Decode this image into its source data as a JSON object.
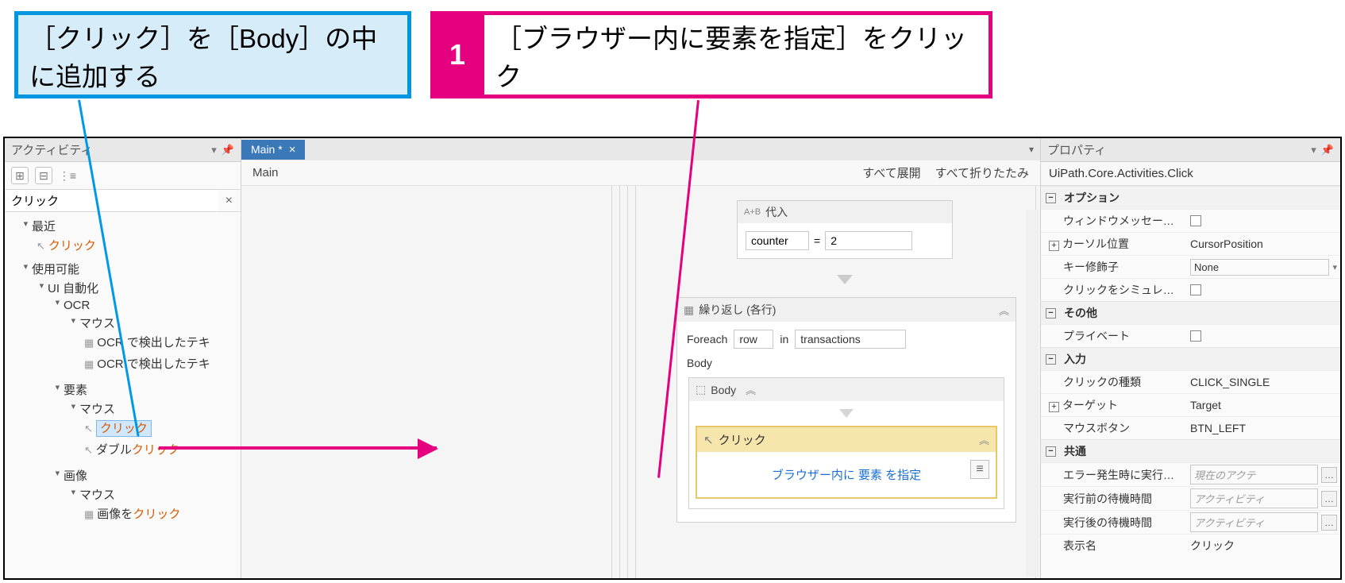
{
  "callouts": {
    "blue": "［クリック］を［Body］の中に追加する",
    "pink_badge": "1",
    "pink": "［ブラウザー内に要素を指定］をクリック"
  },
  "left_panel": {
    "title": "アクティビティ",
    "search_value": "クリック",
    "tree": {
      "recent": "最近",
      "recent_item": "クリック",
      "available": "使用可能",
      "ui_auto": "UI 自動化",
      "ocr": "OCR",
      "mouse1": "マウス",
      "ocr_text1": "OCR で検出したテキ",
      "ocr_text2": "OCR で検出したテキ",
      "element": "要素",
      "mouse2": "マウス",
      "click": "クリック",
      "dblclick_pre": "ダブル",
      "dblclick_hl": "クリック",
      "image": "画像",
      "mouse3": "マウス",
      "img_pre": "画像を",
      "img_hl": "クリック"
    }
  },
  "center": {
    "tab": "Main *",
    "breadcrumb": "Main",
    "expand_all": "すべて展開",
    "collapse_all": "すべて折りたたみ",
    "assign": {
      "title": "代入",
      "ab": "A+B",
      "var": "counter",
      "eq": "=",
      "val": "2"
    },
    "foreach": {
      "title": "繰り返し (各行)",
      "foreach_lbl": "Foreach",
      "row": "row",
      "in": "in",
      "coll": "transactions",
      "body": "Body"
    },
    "body_box_title": "Body",
    "click_activity": {
      "title": "クリック",
      "indicate": "ブラウザー内に 要素 を指定"
    }
  },
  "right_panel": {
    "title": "プロパティ",
    "type": "UiPath.Core.Activities.Click",
    "cat_options": "オプション",
    "send_window_msg": "ウィンドウメッセージを送信",
    "cursor_pos_k": "カーソル位置",
    "cursor_pos_v": "CursorPosition",
    "key_mod_k": "キー修飾子",
    "key_mod_v": "None",
    "simulate_k": "クリックをシミュレート",
    "cat_other": "その他",
    "private_k": "プライベート",
    "cat_input": "入力",
    "click_type_k": "クリックの種類",
    "click_type_v": "CLICK_SINGLE",
    "target_k": "ターゲット",
    "target_v": "Target",
    "mouse_btn_k": "マウスボタン",
    "mouse_btn_v": "BTN_LEFT",
    "cat_common": "共通",
    "cont_err_k": "エラー発生時に実行を継...",
    "cont_err_v": "現在のアクテ",
    "delay_before_k": "実行前の待機時間",
    "delay_before_v": "アクティビティ",
    "delay_after_k": "実行後の待機時間",
    "delay_after_v": "アクティビティ",
    "display_name_k": "表示名",
    "display_name_v": "クリック"
  }
}
